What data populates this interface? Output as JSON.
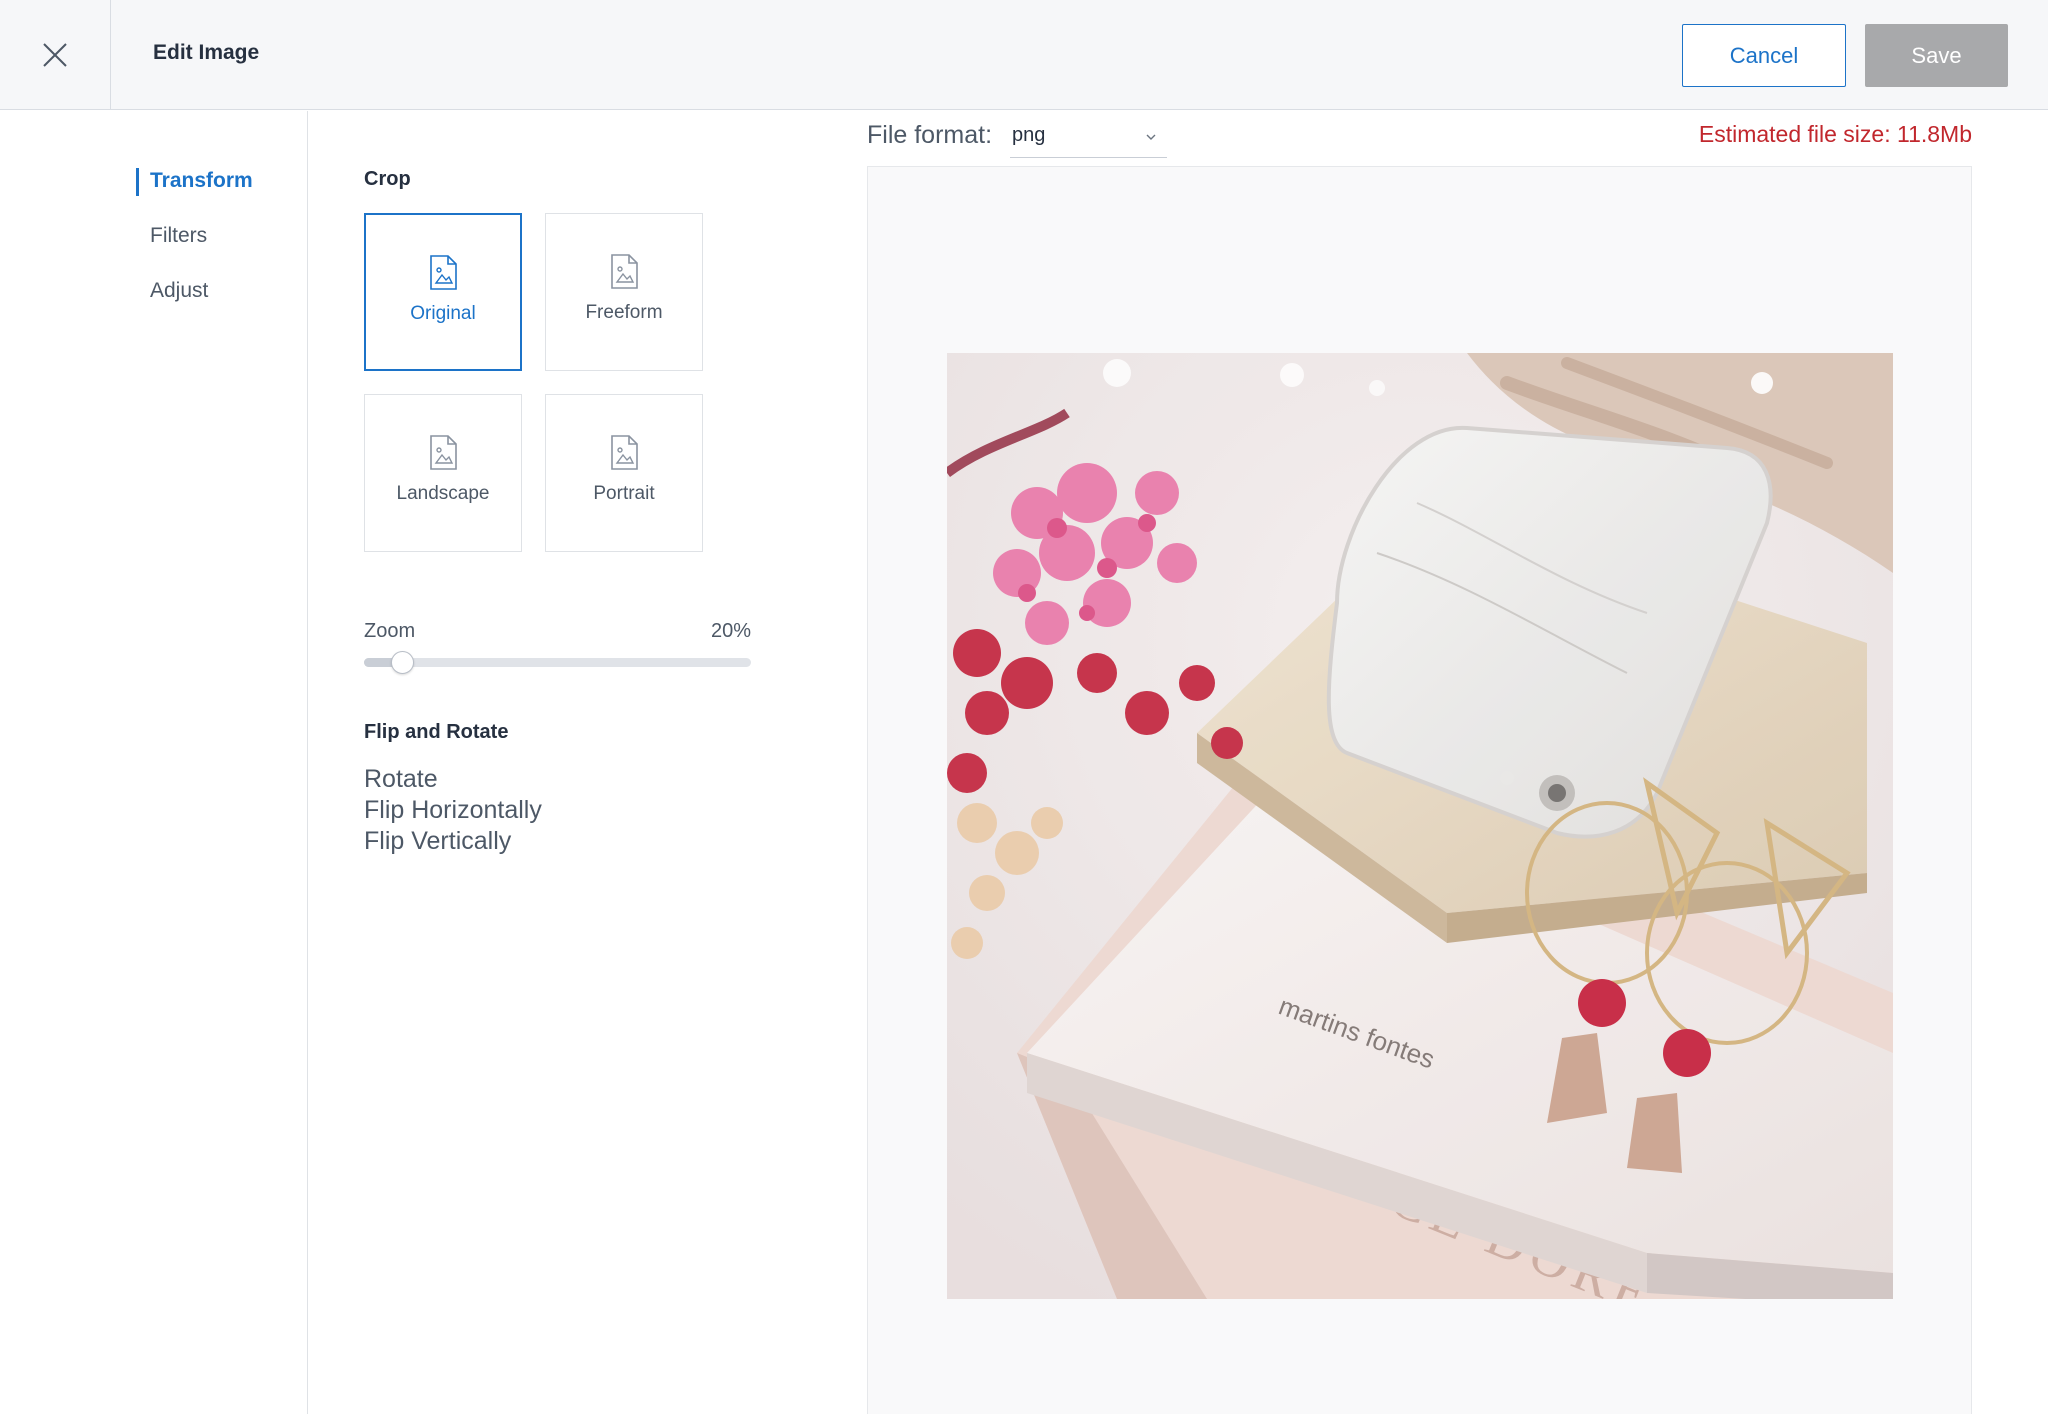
{
  "header": {
    "title": "Edit Image",
    "cancel_label": "Cancel",
    "save_label": "Save",
    "close_icon": "close-icon"
  },
  "nav": {
    "items": [
      {
        "label": "Transform",
        "active": true
      },
      {
        "label": "Filters",
        "active": false
      },
      {
        "label": "Adjust",
        "active": false
      }
    ]
  },
  "crop": {
    "title": "Crop",
    "options": [
      {
        "label": "Original",
        "icon": "image-file-icon",
        "selected": true
      },
      {
        "label": "Freeform",
        "icon": "image-file-icon",
        "selected": false
      },
      {
        "label": "Landscape",
        "icon": "image-file-icon",
        "selected": false
      },
      {
        "label": "Portrait",
        "icon": "image-file-icon",
        "selected": false
      }
    ]
  },
  "zoom": {
    "label": "Zoom",
    "value_text": "20%",
    "value_fraction": 0.1
  },
  "flip_rotate": {
    "title": "Flip and Rotate",
    "actions": [
      "Rotate",
      "Flip Horizontally",
      "Flip Vertically"
    ]
  },
  "preview": {
    "format_label": "File format:",
    "format_value": "png",
    "file_size": "Estimated file size: 11.8Mb"
  },
  "colors": {
    "accent": "#1c73c8",
    "warning": "#c1272d",
    "save_disabled": "#a8a9ab"
  }
}
